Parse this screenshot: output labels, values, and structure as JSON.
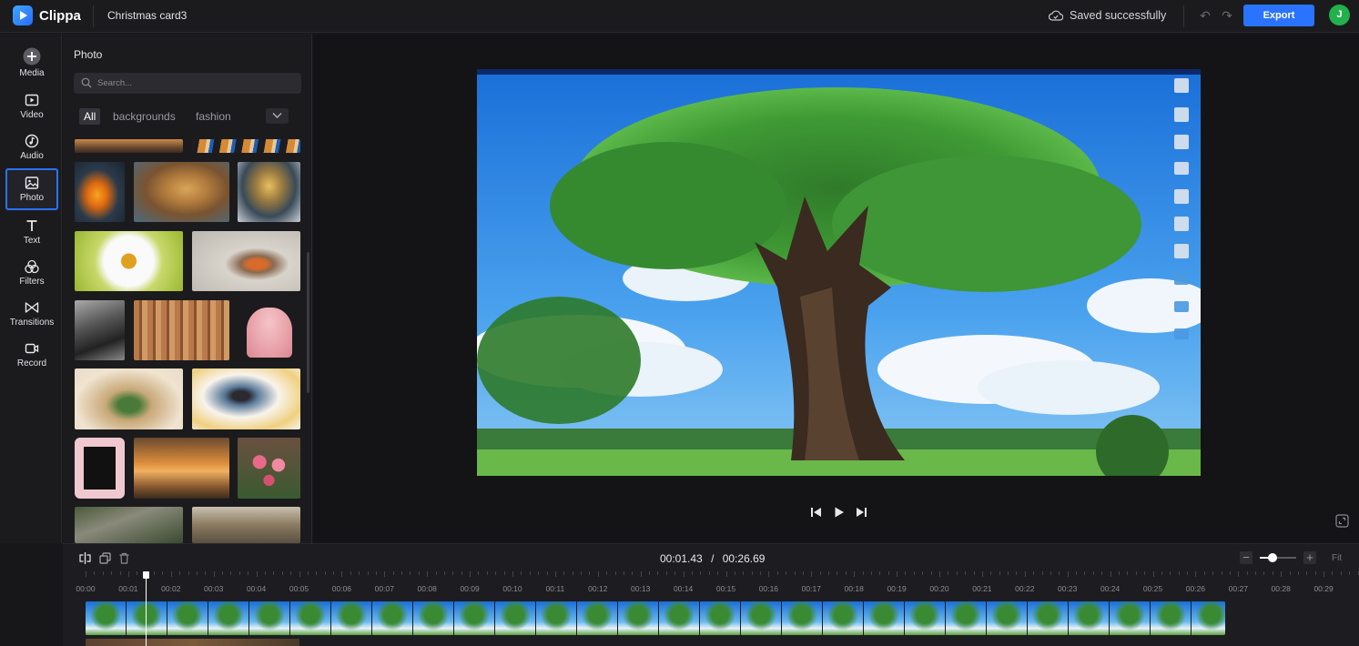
{
  "app": {
    "name": "Clippa",
    "project_title": "Christmas card3",
    "save_status": "Saved successfully",
    "export_label": "Export",
    "avatar_initial": "J"
  },
  "rail": {
    "items": [
      {
        "label": "Media",
        "icon": "plus-circle-icon",
        "active": false
      },
      {
        "label": "Video",
        "icon": "video-icon",
        "active": false
      },
      {
        "label": "Audio",
        "icon": "music-icon",
        "active": false
      },
      {
        "label": "Photo",
        "icon": "image-icon",
        "active": true
      },
      {
        "label": "Text",
        "icon": "text-icon",
        "active": false
      },
      {
        "label": "Filters",
        "icon": "filters-icon",
        "active": false
      },
      {
        "label": "Transitions",
        "icon": "bowtie-icon",
        "active": false
      },
      {
        "label": "Record",
        "icon": "camera-icon",
        "active": false
      }
    ]
  },
  "panel": {
    "title": "Photo",
    "search_placeholder": "Search...",
    "filters": [
      "All",
      "backgrounds",
      "fashion"
    ],
    "active_filter": "All",
    "photos": [
      "sunset beach strip",
      "tiger strip",
      "goldfish",
      "cougar",
      "fish splash",
      "daisy",
      "robin",
      "old building",
      "ancient wall",
      "pink bell",
      "holiday fireplace",
      "penguin on books",
      "pink frame",
      "orange clouds",
      "pink roses",
      "bird on branch",
      "mountain lake"
    ]
  },
  "player": {
    "current_time": "00:01.43",
    "separator": "/",
    "total_time": "00:26.69",
    "fit_label": "Fit",
    "zoom_level": 0.35
  },
  "timeline": {
    "ruler": [
      "00:00",
      "00:01",
      "00:02",
      "00:03",
      "00:04",
      "00:05",
      "00:06",
      "00:07",
      "00:08",
      "00:09",
      "00:10",
      "00:11",
      "00:12",
      "00:13",
      "00:14",
      "00:15",
      "00:16",
      "00:17",
      "00:18",
      "00:19",
      "00:20",
      "00:21",
      "00:22",
      "00:23",
      "00:24",
      "00:25",
      "00:26",
      "00:27",
      "00:28",
      "00:29"
    ]
  },
  "colors": {
    "accent": "#2a73ff",
    "avatar": "#22b14c",
    "background": "#17171a"
  }
}
